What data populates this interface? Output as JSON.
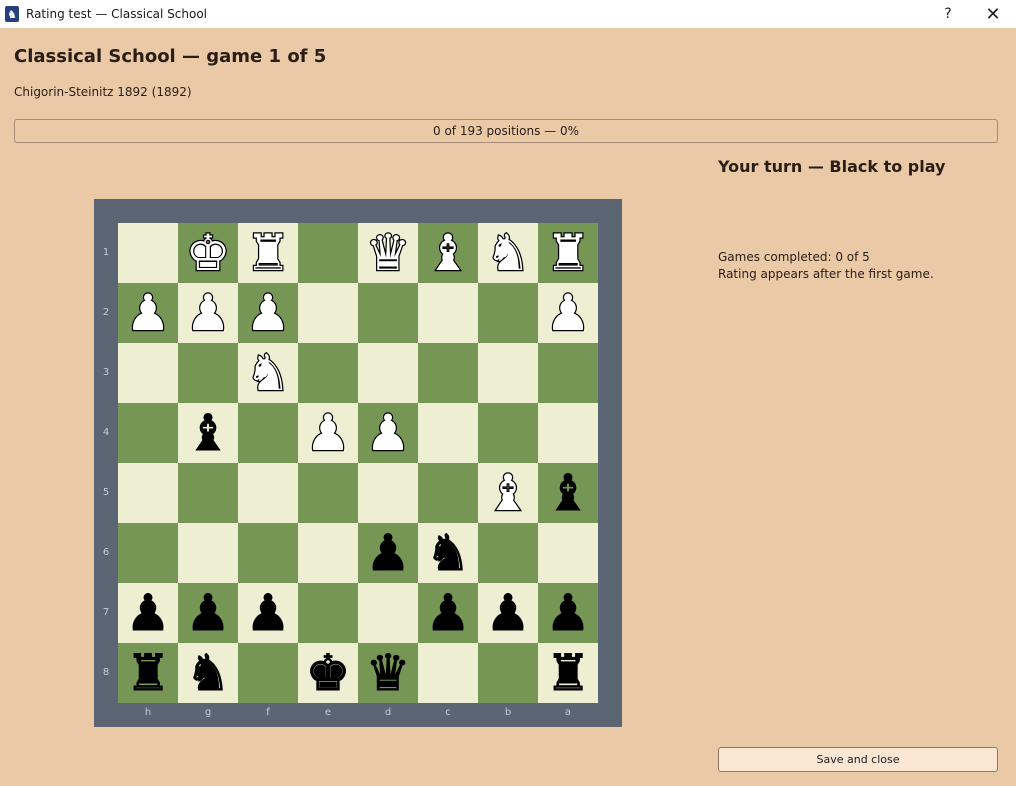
{
  "window": {
    "title": "Rating test — Classical School",
    "help_glyph": "?",
    "close_glyph": "✕",
    "app_glyph": "♞"
  },
  "header": {
    "title": "Classical School — game 1 of 5",
    "subtitle": "Chigorin-Steinitz 1892 (1892)"
  },
  "progress": {
    "text": "0 of 193 positions — 0%",
    "value_fraction": 0
  },
  "side_panel": {
    "turn": "Your turn — Black to play",
    "games_completed": "Games completed: 0 of 5",
    "rating_note": "Rating appears after the first game."
  },
  "save_button": {
    "label": "Save and close"
  },
  "board": {
    "orientation": "black",
    "light_color": "#eeeed2",
    "dark_color": "#769656",
    "frame_color": "#5b6574",
    "ranks_top_to_bottom": [
      "1",
      "2",
      "3",
      "4",
      "5",
      "6",
      "7",
      "8"
    ],
    "files_left_to_right": [
      "h",
      "g",
      "f",
      "e",
      "d",
      "c",
      "b",
      "a"
    ],
    "pieces": [
      {
        "square": "g1",
        "color": "white",
        "type": "king"
      },
      {
        "square": "f1",
        "color": "white",
        "type": "rook"
      },
      {
        "square": "d1",
        "color": "white",
        "type": "queen"
      },
      {
        "square": "c1",
        "color": "white",
        "type": "bishop"
      },
      {
        "square": "b1",
        "color": "white",
        "type": "knight"
      },
      {
        "square": "a1",
        "color": "white",
        "type": "rook"
      },
      {
        "square": "h2",
        "color": "white",
        "type": "pawn"
      },
      {
        "square": "g2",
        "color": "white",
        "type": "pawn"
      },
      {
        "square": "f2",
        "color": "white",
        "type": "pawn"
      },
      {
        "square": "a2",
        "color": "white",
        "type": "pawn"
      },
      {
        "square": "f3",
        "color": "white",
        "type": "knight"
      },
      {
        "square": "g4",
        "color": "black",
        "type": "bishop"
      },
      {
        "square": "e4",
        "color": "white",
        "type": "pawn"
      },
      {
        "square": "d4",
        "color": "white",
        "type": "pawn"
      },
      {
        "square": "b5",
        "color": "white",
        "type": "bishop"
      },
      {
        "square": "a5",
        "color": "black",
        "type": "bishop"
      },
      {
        "square": "d6",
        "color": "black",
        "type": "pawn"
      },
      {
        "square": "c6",
        "color": "black",
        "type": "knight"
      },
      {
        "square": "h7",
        "color": "black",
        "type": "pawn"
      },
      {
        "square": "g7",
        "color": "black",
        "type": "pawn"
      },
      {
        "square": "f7",
        "color": "black",
        "type": "pawn"
      },
      {
        "square": "c7",
        "color": "black",
        "type": "pawn"
      },
      {
        "square": "b7",
        "color": "black",
        "type": "pawn"
      },
      {
        "square": "a7",
        "color": "black",
        "type": "pawn"
      },
      {
        "square": "h8",
        "color": "black",
        "type": "rook"
      },
      {
        "square": "g8",
        "color": "black",
        "type": "knight"
      },
      {
        "square": "e8",
        "color": "black",
        "type": "king"
      },
      {
        "square": "d8",
        "color": "black",
        "type": "queen"
      },
      {
        "square": "a8",
        "color": "black",
        "type": "rook"
      }
    ]
  }
}
